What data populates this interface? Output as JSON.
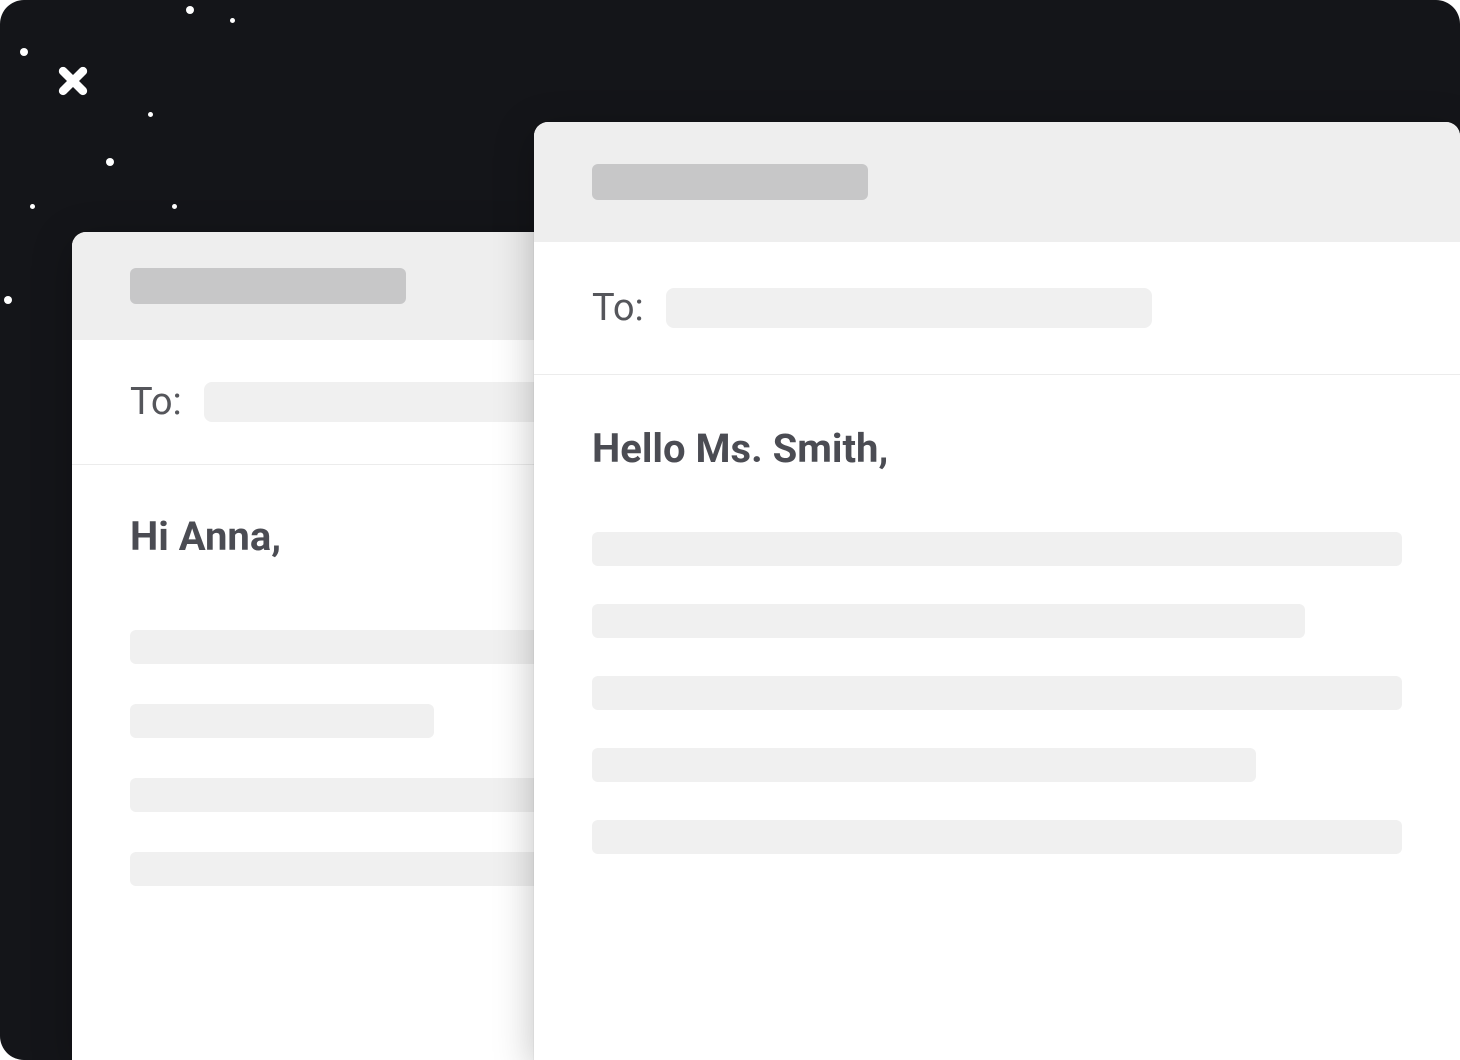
{
  "emails": {
    "back": {
      "to_label": "To:",
      "greeting": "Hi Anna,"
    },
    "front": {
      "to_label": "To:",
      "greeting": "Hello Ms. Smith,"
    }
  }
}
